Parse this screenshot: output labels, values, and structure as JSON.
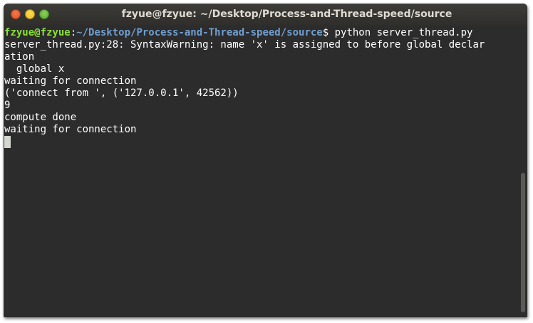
{
  "window": {
    "title": "fzyue@fzyue: ~/Desktop/Process-and-Thread-speed/source"
  },
  "terminal": {
    "prompt": {
      "user_host": "fzyue@fzyue",
      "separator": ":",
      "path": "~/Desktop/Process-and-Thread-speed/source",
      "symbol": "$ ",
      "command": "python server_thread.py"
    },
    "output_lines": [
      "server_thread.py:28: SyntaxWarning: name 'x' is assigned to before global declar",
      "ation",
      "  global x",
      "waiting for connection",
      "('connect from ', ('127.0.0.1', 42562))",
      "9",
      "compute done",
      "waiting for connection"
    ]
  },
  "colors": {
    "background": "#2c2c2c",
    "prompt_user": "#8ae234",
    "prompt_path": "#729fcf",
    "text": "#ffffff"
  }
}
